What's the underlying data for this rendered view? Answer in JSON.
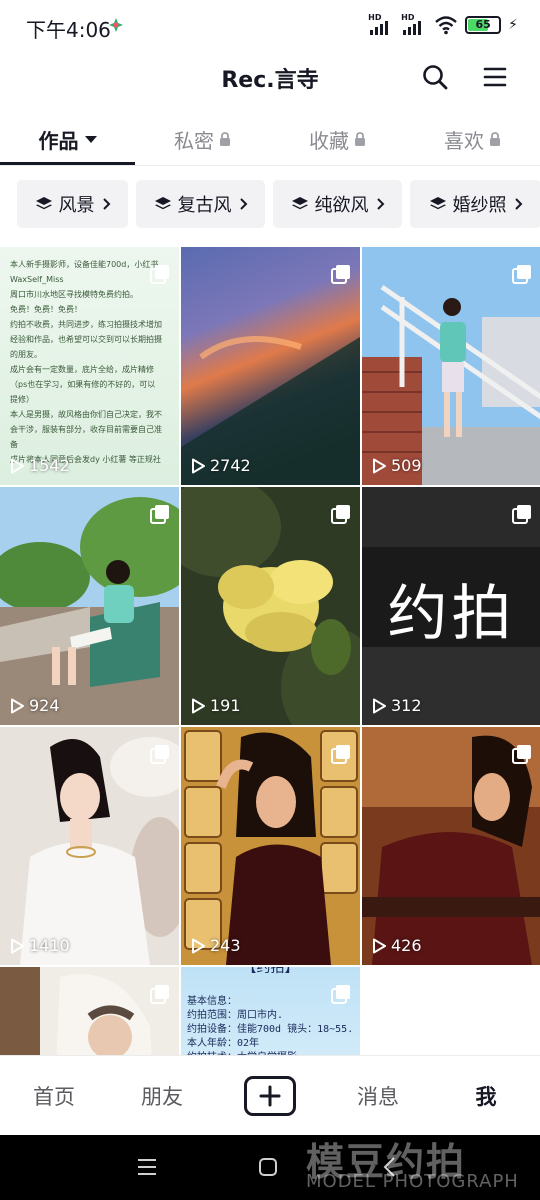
{
  "status_bar": {
    "time": "下午4:06",
    "battery": "65",
    "battery_level": 0.65,
    "signal_label_1": "HD",
    "signal_label_2": "HD"
  },
  "header": {
    "title": "Rec.言寺",
    "search_icon": "search-icon",
    "menu_icon": "menu-icon"
  },
  "tabs": [
    {
      "label": "作品",
      "active": true
    },
    {
      "label": "私密",
      "locked": true
    },
    {
      "label": "收藏",
      "locked": true
    },
    {
      "label": "喜欢",
      "locked": true
    }
  ],
  "chips": [
    {
      "label": "风景"
    },
    {
      "label": "复古风"
    },
    {
      "label": "纯欲风"
    },
    {
      "label": "婚纱照"
    }
  ],
  "grid": {
    "items": [
      {
        "plays": "1542",
        "notes": [
          "本人新手摄影师，设备佳能700d，小红书",
          "WaxSelf_Miss",
          "周口市川水地区寻找模特免费约拍。",
          "免费！免费！免费！",
          "约拍不收费，共同进步，练习拍摄技术增加",
          "经验和作品，也希望可以交到可以长期拍摄",
          "的朋友。",
          "成片会有一定数量，底片全给，成片精修",
          "（ps也在学习，如果有修的不好的，可以",
          "提修）",
          "本人是男摄，故风格由你们自己决定，我不",
          "会干涉，服装有部分，收存目前需要自己准",
          "备",
          "成片将本人同意后会发dy 小红薯 等正规社"
        ]
      },
      {
        "plays": "2742"
      },
      {
        "plays": "509"
      },
      {
        "plays": "924"
      },
      {
        "plays": "191"
      },
      {
        "plays": "312",
        "text": "约拍"
      },
      {
        "plays": "1410"
      },
      {
        "plays": "243"
      },
      {
        "plays": "426"
      },
      {
        "plays": ""
      },
      {
        "plays": "",
        "header_text": "【约拍】",
        "lines": [
          "基本信息：",
          "约拍范围：周口市内.",
          "约拍设备：佳能700d 镜头：18~55.",
          "本人年龄：02年",
          "约拍技术：大学自学摄影"
        ]
      }
    ]
  },
  "bottom_nav": {
    "home": "首页",
    "friends": "朋友",
    "messages": "消息",
    "me": "我"
  },
  "watermark": {
    "main": "模豆约拍",
    "sub": "MODEL PHOTOGRAPH"
  },
  "colors": {
    "text_primary": "#161823",
    "text_secondary": "#8a8b91",
    "chip_bg": "#f2f2f4",
    "battery_green": "#4cd964"
  }
}
